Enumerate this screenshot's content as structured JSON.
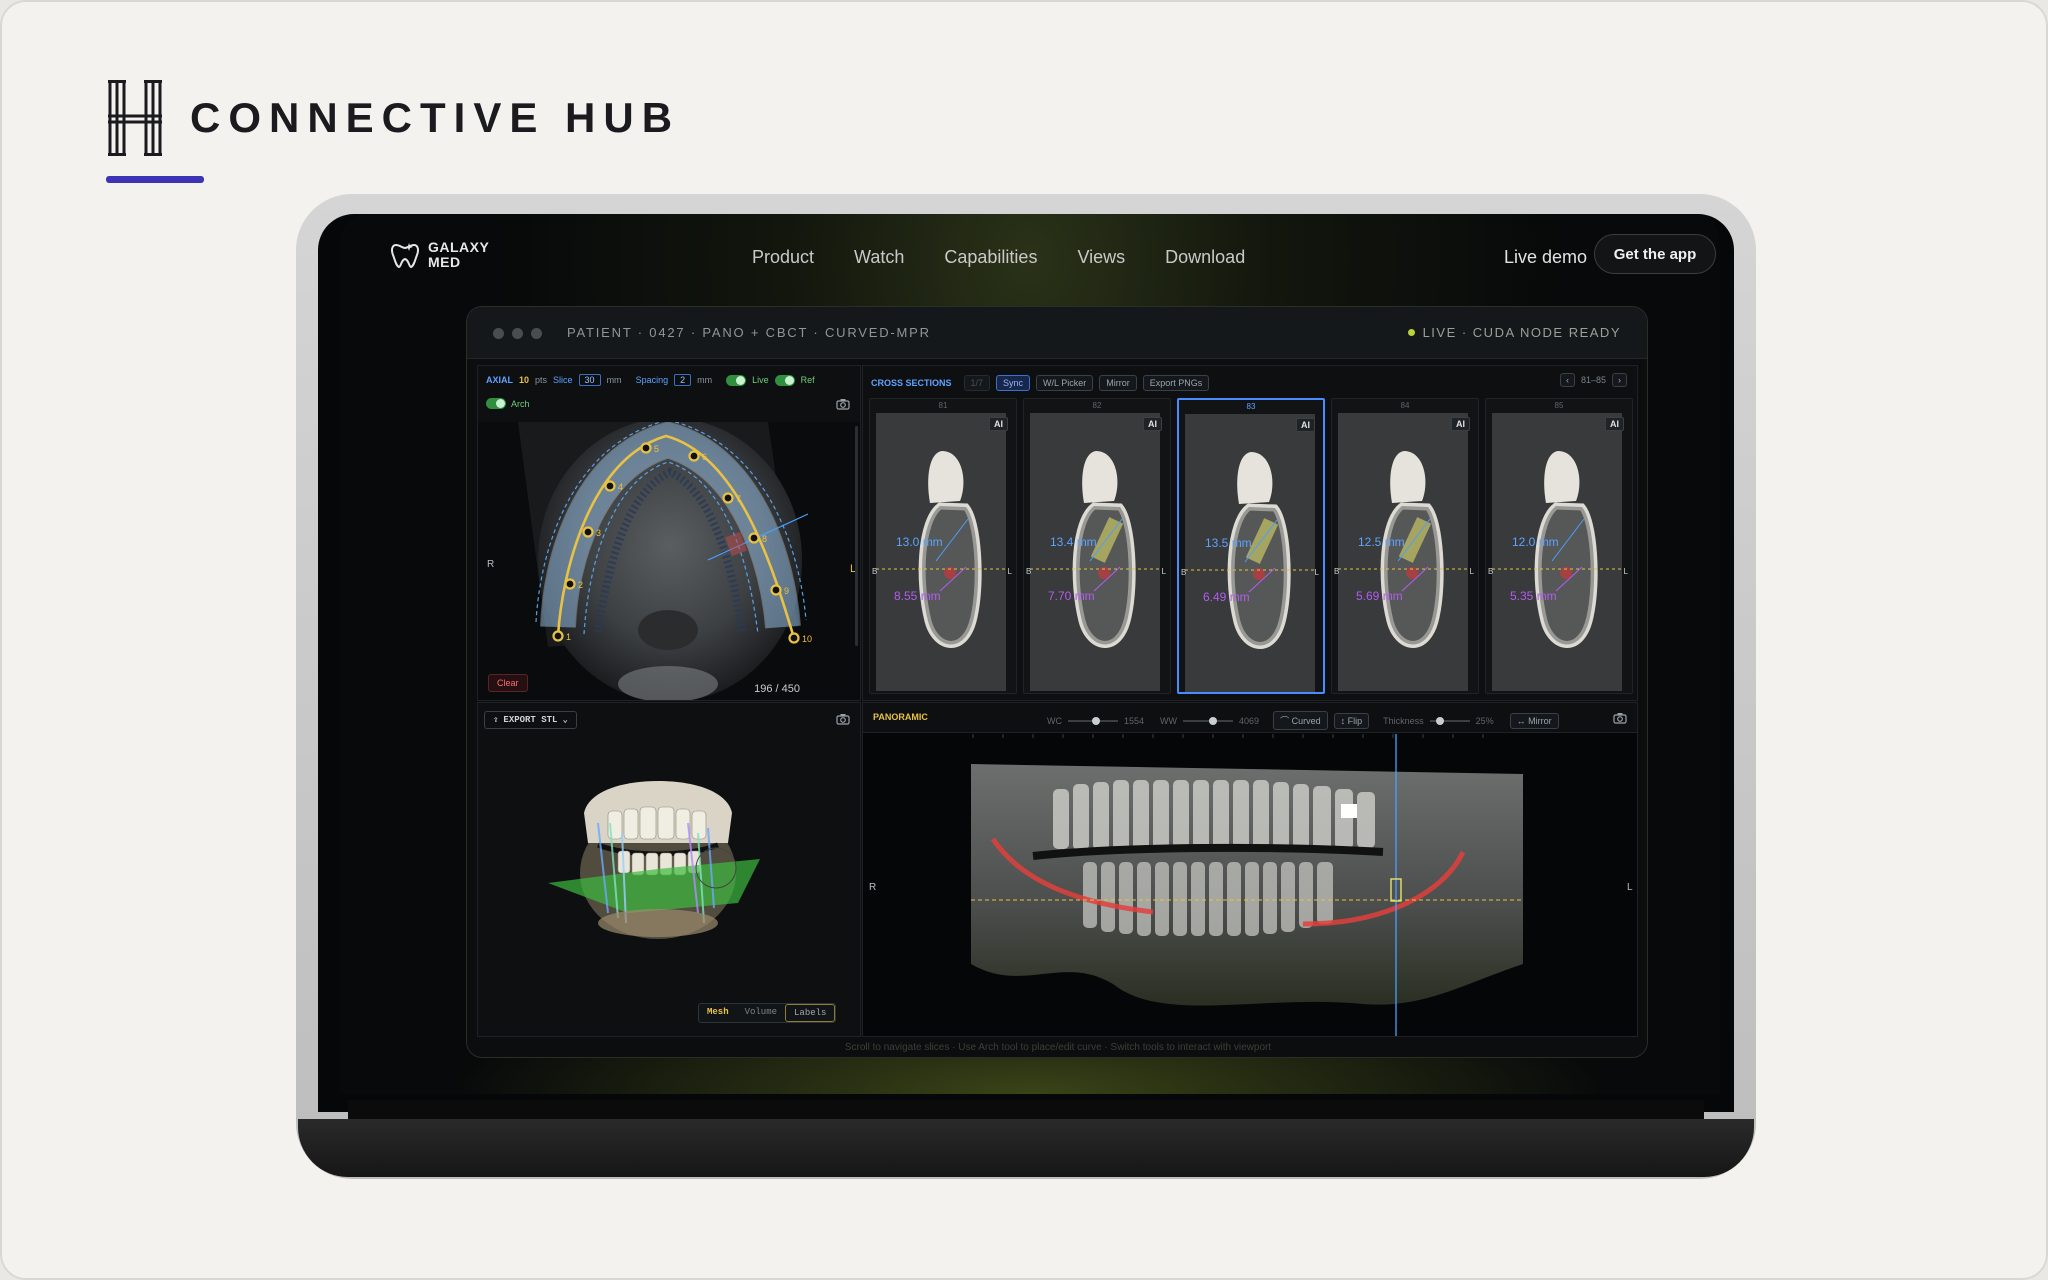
{
  "brand": {
    "name": "CONNECTIVE HUB"
  },
  "site": {
    "logo_line1": "GALAXY",
    "logo_line2": "MED",
    "nav": [
      "Product",
      "Watch",
      "Capabilities",
      "Views",
      "Download"
    ],
    "live_demo": "Live demo",
    "cta": "Get the app"
  },
  "app": {
    "title": "PATIENT · 0427 · PANO + CBCT · CURVED-MPR",
    "status": "LIVE · CUDA NODE READY",
    "axial": {
      "label": "AXIAL",
      "pts_value": "10",
      "pts_unit": "pts",
      "slice_label": "Slice",
      "slice_value": "30",
      "slice_unit": "mm",
      "spacing_label": "Spacing",
      "spacing_value": "2",
      "spacing_unit": "mm",
      "live_label": "Live",
      "ref_label": "Ref",
      "arch_label": "Arch",
      "side_left": "R",
      "side_right": "L",
      "clear_label": "Clear",
      "slice_counter": "196 / 450",
      "arch_points": [
        "1",
        "2",
        "3",
        "4",
        "5",
        "6",
        "7",
        "8",
        "9",
        "10"
      ]
    },
    "cross": {
      "label": "CROSS SECTIONS",
      "count_chip": "1/7",
      "chips": [
        "Sync",
        "W/L Picker",
        "Mirror",
        "Export PNGs"
      ],
      "range": "81–85",
      "slices": [
        {
          "id": "81",
          "upper": "13.0 mm",
          "lower": "8.55 mm",
          "implant": false,
          "selected": false
        },
        {
          "id": "82",
          "upper": "13.4 mm",
          "lower": "7.70 mm",
          "implant": true,
          "selected": false
        },
        {
          "id": "83",
          "upper": "13.5 mm",
          "lower": "6.49 mm",
          "implant": true,
          "selected": true
        },
        {
          "id": "84",
          "upper": "12.5 mm",
          "lower": "5.69 mm",
          "implant": true,
          "selected": false
        },
        {
          "id": "85",
          "upper": "12.0 mm",
          "lower": "5.35 mm",
          "implant": false,
          "selected": false
        }
      ],
      "ai_badge": "AI",
      "side_b": "B",
      "side_l": "L"
    },
    "model3d": {
      "export_label": "EXPORT STL",
      "modes": [
        "Mesh",
        "Volume",
        "Labels"
      ]
    },
    "pano": {
      "label": "PANORAMIC",
      "wc_label": "WC",
      "wc_value": "1554",
      "ww_label": "WW",
      "ww_value": "4069",
      "curved_label": "Curved",
      "flip_label": "Flip",
      "thickness_label": "Thickness",
      "thickness_value": "25%",
      "mirror_label": "Mirror",
      "wc_level": 0.55,
      "ww_level": 0.6,
      "thickness_level": 0.25,
      "side_left": "R",
      "side_right": "L"
    },
    "hint": "Scroll to navigate slices · Use Arch tool to place/edit curve · Switch tools to interact with viewport"
  },
  "colors": {
    "accent_yellow": "#e8c244",
    "accent_blue": "#5ea3ff",
    "measure_purple": "#b45cf0",
    "brand_underline": "#3c34b5"
  }
}
